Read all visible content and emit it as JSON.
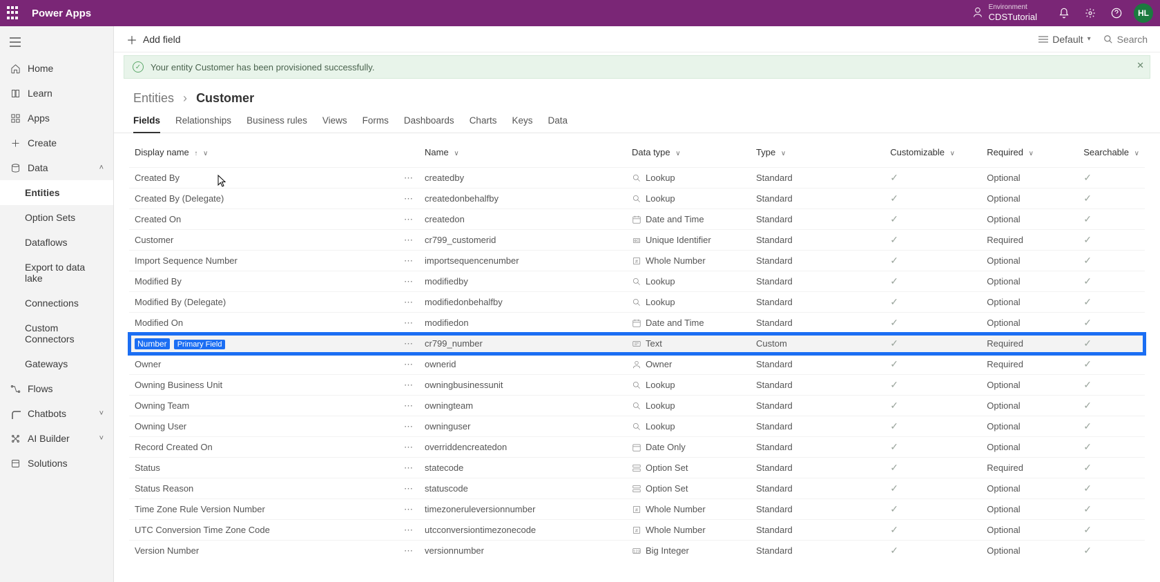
{
  "topbar": {
    "brand": "Power Apps",
    "env_label": "Environment",
    "env_value": "CDSTutorial",
    "avatar": "HL"
  },
  "sidebar": {
    "items": [
      {
        "id": "home",
        "label": "Home"
      },
      {
        "id": "learn",
        "label": "Learn"
      },
      {
        "id": "apps",
        "label": "Apps"
      },
      {
        "id": "create",
        "label": "Create"
      },
      {
        "id": "data",
        "label": "Data",
        "expandable": true,
        "expanded": true
      },
      {
        "id": "entities",
        "label": "Entities",
        "sub": true,
        "active": true
      },
      {
        "id": "optionsets",
        "label": "Option Sets",
        "sub": true
      },
      {
        "id": "dataflows",
        "label": "Dataflows",
        "sub": true
      },
      {
        "id": "export",
        "label": "Export to data lake",
        "sub": true
      },
      {
        "id": "connections",
        "label": "Connections",
        "sub": true
      },
      {
        "id": "connectors",
        "label": "Custom Connectors",
        "sub": true
      },
      {
        "id": "gateways",
        "label": "Gateways",
        "sub": true
      },
      {
        "id": "flows",
        "label": "Flows"
      },
      {
        "id": "chatbots",
        "label": "Chatbots",
        "expandable": true
      },
      {
        "id": "ai",
        "label": "AI Builder",
        "expandable": true
      },
      {
        "id": "solutions",
        "label": "Solutions"
      }
    ]
  },
  "cmdbar": {
    "add": "Add field",
    "view_label": "Default",
    "search": "Search"
  },
  "banner": "Your entity Customer has been provisioned successfully.",
  "crumbs": {
    "root": "Entities",
    "current": "Customer"
  },
  "tabs": [
    "Fields",
    "Relationships",
    "Business rules",
    "Views",
    "Forms",
    "Dashboards",
    "Charts",
    "Keys",
    "Data"
  ],
  "active_tab": "Fields",
  "columns": {
    "display": "Display name",
    "name": "Name",
    "datatype": "Data type",
    "type": "Type",
    "custom": "Customizable",
    "required": "Required",
    "search": "Searchable"
  },
  "primary_badge": "Primary Field",
  "rows": [
    {
      "display": "Created By",
      "name": "createdby",
      "datatype": "Lookup",
      "dtype": "lookup",
      "type": "Standard",
      "custom": true,
      "required": "Optional",
      "search": true
    },
    {
      "display": "Created By (Delegate)",
      "name": "createdonbehalfby",
      "datatype": "Lookup",
      "dtype": "lookup",
      "type": "Standard",
      "custom": true,
      "required": "Optional",
      "search": true
    },
    {
      "display": "Created On",
      "name": "createdon",
      "datatype": "Date and Time",
      "dtype": "datetime",
      "type": "Standard",
      "custom": true,
      "required": "Optional",
      "search": true
    },
    {
      "display": "Customer",
      "name": "cr799_customerid",
      "datatype": "Unique Identifier",
      "dtype": "uid",
      "type": "Standard",
      "custom": true,
      "required": "Required",
      "search": true
    },
    {
      "display": "Import Sequence Number",
      "name": "importsequencenumber",
      "datatype": "Whole Number",
      "dtype": "number",
      "type": "Standard",
      "custom": true,
      "required": "Optional",
      "search": true
    },
    {
      "display": "Modified By",
      "name": "modifiedby",
      "datatype": "Lookup",
      "dtype": "lookup",
      "type": "Standard",
      "custom": true,
      "required": "Optional",
      "search": true
    },
    {
      "display": "Modified By (Delegate)",
      "name": "modifiedonbehalfby",
      "datatype": "Lookup",
      "dtype": "lookup",
      "type": "Standard",
      "custom": true,
      "required": "Optional",
      "search": true
    },
    {
      "display": "Modified On",
      "name": "modifiedon",
      "datatype": "Date and Time",
      "dtype": "datetime",
      "type": "Standard",
      "custom": true,
      "required": "Optional",
      "search": true
    },
    {
      "display": "Number",
      "name": "cr799_number",
      "datatype": "Text",
      "dtype": "text",
      "type": "Custom",
      "custom": true,
      "required": "Required",
      "search": true,
      "highlight": true,
      "primary": true
    },
    {
      "display": "Owner",
      "name": "ownerid",
      "datatype": "Owner",
      "dtype": "owner",
      "type": "Standard",
      "custom": true,
      "required": "Required",
      "search": true
    },
    {
      "display": "Owning Business Unit",
      "name": "owningbusinessunit",
      "datatype": "Lookup",
      "dtype": "lookup",
      "type": "Standard",
      "custom": true,
      "required": "Optional",
      "search": true
    },
    {
      "display": "Owning Team",
      "name": "owningteam",
      "datatype": "Lookup",
      "dtype": "lookup",
      "type": "Standard",
      "custom": true,
      "required": "Optional",
      "search": true
    },
    {
      "display": "Owning User",
      "name": "owninguser",
      "datatype": "Lookup",
      "dtype": "lookup",
      "type": "Standard",
      "custom": true,
      "required": "Optional",
      "search": true
    },
    {
      "display": "Record Created On",
      "name": "overriddencreatedon",
      "datatype": "Date Only",
      "dtype": "date",
      "type": "Standard",
      "custom": true,
      "required": "Optional",
      "search": true
    },
    {
      "display": "Status",
      "name": "statecode",
      "datatype": "Option Set",
      "dtype": "option",
      "type": "Standard",
      "custom": true,
      "required": "Required",
      "search": true
    },
    {
      "display": "Status Reason",
      "name": "statuscode",
      "datatype": "Option Set",
      "dtype": "option",
      "type": "Standard",
      "custom": true,
      "required": "Optional",
      "search": true
    },
    {
      "display": "Time Zone Rule Version Number",
      "name": "timezoneruleversionnumber",
      "datatype": "Whole Number",
      "dtype": "number",
      "type": "Standard",
      "custom": true,
      "required": "Optional",
      "search": true
    },
    {
      "display": "UTC Conversion Time Zone Code",
      "name": "utcconversiontimezonecode",
      "datatype": "Whole Number",
      "dtype": "number",
      "type": "Standard",
      "custom": true,
      "required": "Optional",
      "search": true
    },
    {
      "display": "Version Number",
      "name": "versionnumber",
      "datatype": "Big Integer",
      "dtype": "bigint",
      "type": "Standard",
      "custom": true,
      "required": "Optional",
      "search": true
    }
  ]
}
